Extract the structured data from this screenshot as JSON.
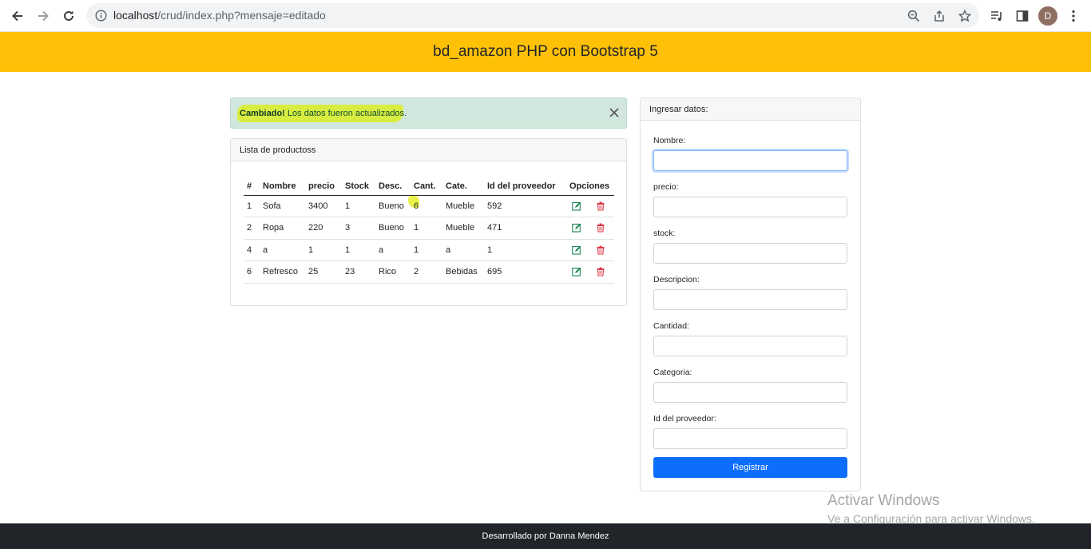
{
  "browser": {
    "url_host": "localhost",
    "url_path": "/crud/index.php?mensaje=editado",
    "profile_initial": "D"
  },
  "header": {
    "title": "bd_amazon PHP con Bootstrap 5"
  },
  "alert": {
    "strong": "Cambiado!",
    "text": " Los datos fueron actualizados."
  },
  "list": {
    "title": "Lista de productoss",
    "columns": [
      "#",
      "Nombre",
      "precio",
      "Stock",
      "Desc.",
      "Cant.",
      "Cate.",
      "Id del proveedor",
      "Opciones"
    ],
    "rows": [
      [
        "1",
        "Sofa",
        "3400",
        "1",
        "Bueno",
        "6",
        "Mueble",
        "592"
      ],
      [
        "2",
        "Ropa",
        "220",
        "3",
        "Bueno",
        "1",
        "Mueble",
        "471"
      ],
      [
        "4",
        "a",
        "1",
        "1",
        "a",
        "1",
        "a",
        "1"
      ],
      [
        "6",
        "Refresco",
        "25",
        "23",
        "Rico",
        "2",
        "Bebidas",
        "695"
      ]
    ]
  },
  "form": {
    "title": "Ingresar datos:",
    "labels": [
      "Nombre:",
      "precio:",
      "stock:",
      "Descripcion:",
      "Cantidad:",
      "Categoria:",
      "Id del proveedor:"
    ],
    "submit": "Registrar"
  },
  "watermark": {
    "line1": "Activar Windows",
    "line2": "Ve a Configuración para activar Windows."
  },
  "footer": {
    "text": "Desarrollado por Danna Mendez"
  },
  "colors": {
    "header": "#ffc107",
    "primary": "#0d6efd",
    "alert_bg": "#d1e7dd",
    "footer": "#212529"
  }
}
